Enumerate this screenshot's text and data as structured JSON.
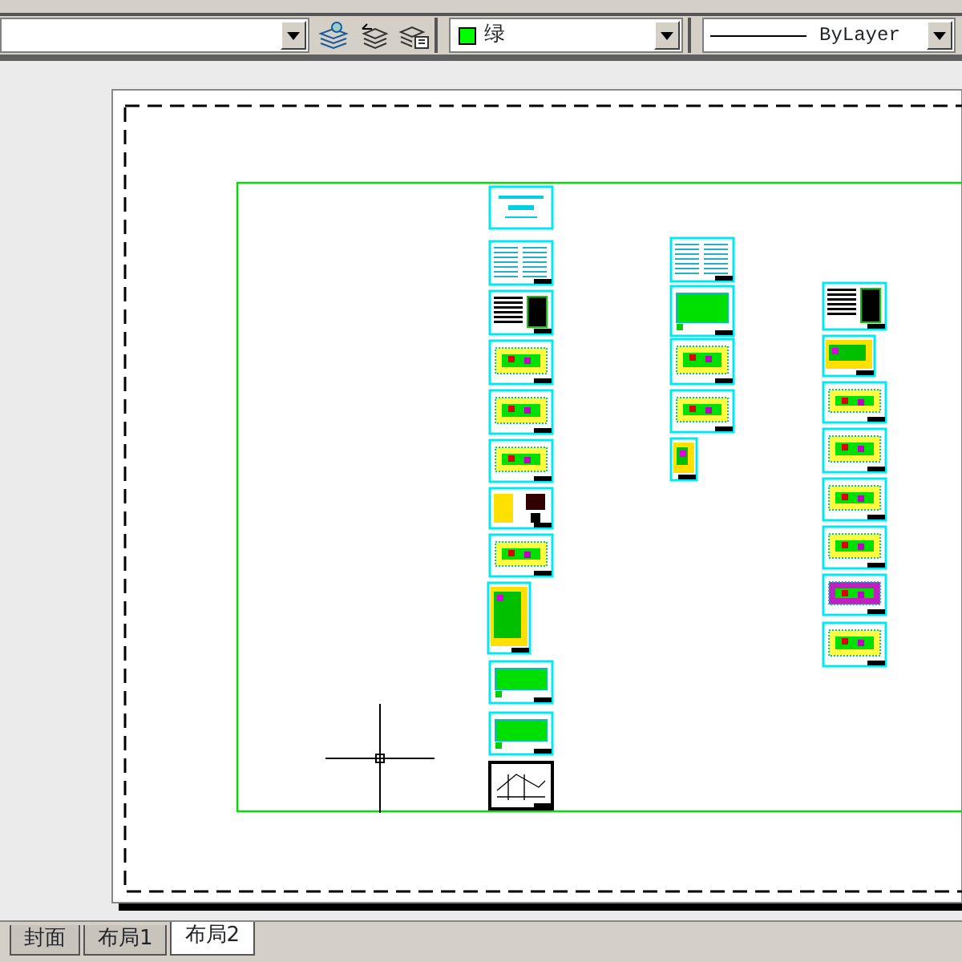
{
  "toolbar": {
    "color_combo": {
      "value": "绿",
      "color": "#00ff00"
    },
    "linetype_combo": {
      "value": "ByLayer"
    }
  },
  "layout_tabs": [
    {
      "label": "封面",
      "selected": false
    },
    {
      "label": "布局1",
      "selected": false
    },
    {
      "label": "布局2",
      "selected": true
    }
  ]
}
